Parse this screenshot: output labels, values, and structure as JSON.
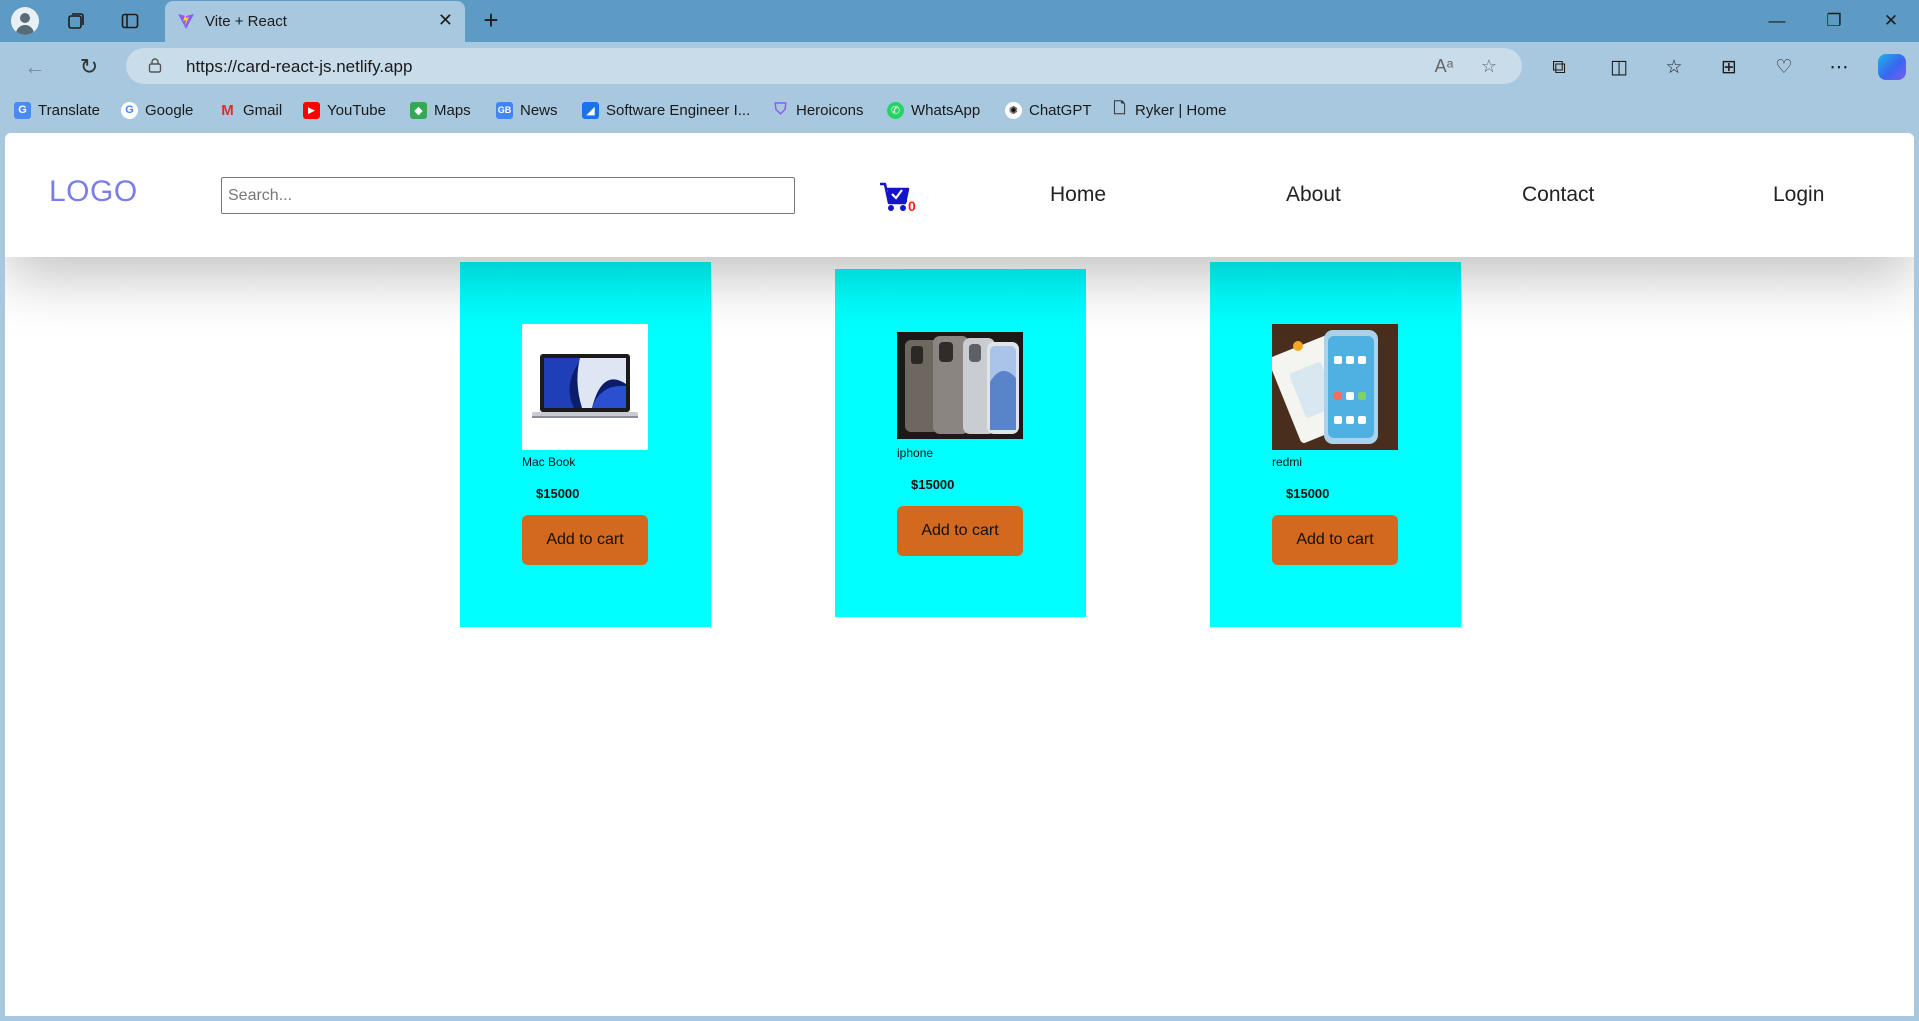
{
  "browser": {
    "tab_title": "Vite + React",
    "url": "https://card-react-js.netlify.app",
    "bookmarks": [
      {
        "label": "Translate",
        "icon": "translate-icon",
        "color": "#4a8af4"
      },
      {
        "label": "Google",
        "icon": "google-icon",
        "color": "#ea4335"
      },
      {
        "label": "Gmail",
        "icon": "gmail-icon",
        "color": "#d93025"
      },
      {
        "label": "YouTube",
        "icon": "youtube-icon",
        "color": "#ff0000"
      },
      {
        "label": "Maps",
        "icon": "maps-icon",
        "color": "#34a853"
      },
      {
        "label": "News",
        "icon": "news-icon",
        "color": "#4285f4"
      },
      {
        "label": "Software Engineer I...",
        "icon": "software-engineer-icon",
        "color": "#1a73e8"
      },
      {
        "label": "Heroicons",
        "icon": "heroicons-icon",
        "color": "#8b5cf6"
      },
      {
        "label": "WhatsApp",
        "icon": "whatsapp-icon",
        "color": "#25d366"
      },
      {
        "label": "ChatGPT",
        "icon": "chatgpt-icon",
        "color": "#111111"
      },
      {
        "label": "Ryker | Home",
        "icon": "document-icon",
        "color": "#333333"
      }
    ]
  },
  "site": {
    "logo": "LOGO",
    "search_placeholder": "Search...",
    "cart_count": "0",
    "nav": [
      "Home",
      "About",
      "Contact",
      "Login"
    ]
  },
  "products": [
    {
      "name": "Mac Book",
      "price": "$15000",
      "button": "Add to cart",
      "image": "macbook-image"
    },
    {
      "name": "iphone",
      "price": "$15000",
      "button": "Add to cart",
      "image": "iphone-image"
    },
    {
      "name": "redmi",
      "price": "$15000",
      "button": "Add to cart",
      "image": "redmi-image"
    }
  ],
  "colors": {
    "card_bg": "#00ffff",
    "button_bg": "#d2691e",
    "logo": "#7b7de8",
    "cart_badge": "#ff1a1a",
    "browser_chrome": "#a7c8de",
    "titlebar": "#5e9bc4"
  }
}
